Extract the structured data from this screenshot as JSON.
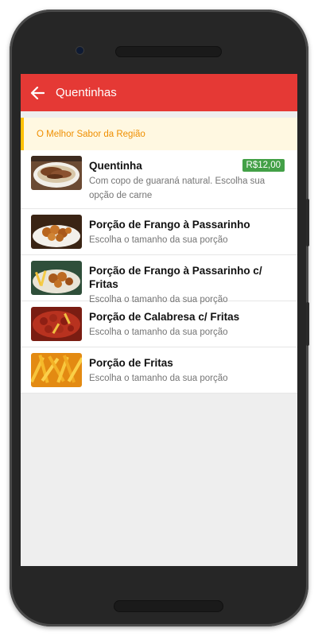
{
  "app_bar": {
    "title": "Quentinhas",
    "back_icon": "arrow-left-icon",
    "color": "#e53935"
  },
  "banner": {
    "text": "O Melhor Sabor da Região",
    "color": "#ef8f00"
  },
  "items": [
    {
      "name": "Quentinha",
      "description": "Com copo de guaraná natural. Escolha sua opção de carne",
      "price": "R$12,00",
      "image": "meat-dish-photo"
    },
    {
      "name": "Porção de Frango à Passarinho",
      "description": "Escolha o tamanho da sua porção",
      "price": "",
      "image": "fried-chicken-photo"
    },
    {
      "name": "Porção de Frango à Passarinho c/ Fritas",
      "description": "Escolha o tamanho da sua porção",
      "price": "",
      "image": "chicken-fries-photo"
    },
    {
      "name": "Porção de Calabresa c/ Fritas",
      "description": "Escolha o tamanho da sua porção",
      "price": "",
      "image": "sausage-fries-photo"
    },
    {
      "name": "Porção de Fritas",
      "description": "Escolha o tamanho da sua porção",
      "price": "",
      "image": "french-fries-photo"
    }
  ],
  "colors": {
    "price_badge": "#43a047",
    "banner_border": "#ffc107",
    "banner_background": "#fff8e1"
  }
}
